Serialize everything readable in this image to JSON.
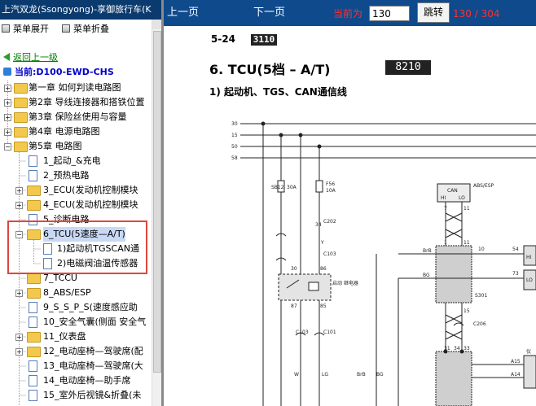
{
  "window": {
    "title": "上汽双龙(Ssongyong)-享御旅行车(K"
  },
  "menu": {
    "expand_label": "菜单展开",
    "collapse_label": "菜单折叠"
  },
  "nav": {
    "back_label": "返回上一级",
    "current_label": "当前:D100-EWD-CHS"
  },
  "tree": {
    "items": [
      {
        "label": "第一章 如何判读电路图"
      },
      {
        "label": "第2章 导线连接器和搭铁位置"
      },
      {
        "label": "第3章 保险丝使用与容量"
      },
      {
        "label": "第4章 电源电路图"
      },
      {
        "label": "第5章 电路图"
      },
      {
        "label": "1_起动_&充电"
      },
      {
        "label": "2_预热电路"
      },
      {
        "label": "3_ECU(发动机控制模块"
      },
      {
        "label": "4_ECU(发动机控制模块"
      },
      {
        "label": "5_诊断电路"
      },
      {
        "label": "6_TCU(5速度—A/T)"
      },
      {
        "label": "1)起动机TGSCAN通"
      },
      {
        "label": "2)电磁阀油温传感器"
      },
      {
        "label": "7_TCCU"
      },
      {
        "label": "8_ABS/ESP"
      },
      {
        "label": "9_S_S_P_S(速度感应助"
      },
      {
        "label": "10_安全气囊(侧面 安全气"
      },
      {
        "label": "11_仪表盘"
      },
      {
        "label": "12_电动座椅—驾驶席(配"
      },
      {
        "label": "13_电动座椅—驾驶席(大"
      },
      {
        "label": "14_电动座椅—助手席"
      },
      {
        "label": "15_室外后视镜&折叠(未"
      }
    ]
  },
  "toolbar": {
    "prev_label": "上一页",
    "next_label": "下一页",
    "page_label": "当前为",
    "page_value": "130",
    "jump_label": "跳转",
    "page_count": "130 / 304"
  },
  "document": {
    "page_ref": "5-24",
    "code1": "3110",
    "title": "6. TCU(5档 – A/T)",
    "code2": "8210",
    "subtitle": "1) 起动机、TGS、CAN通信线",
    "diagram": {
      "wire_labels": [
        "30",
        "15",
        "50",
        "58"
      ],
      "fuse_sb": "SB12",
      "fuse_sb_rating": "30A",
      "fuse_f": "F56",
      "fuse_f_rating": "10A",
      "relay_label": "启动\n继电器",
      "relay_pins": [
        "30",
        "86",
        "87",
        "85"
      ],
      "connectors": [
        "C202",
        "C103",
        "C103",
        "C101",
        "C206"
      ],
      "pins_small": [
        "34",
        "7",
        "11",
        "1",
        "11",
        "15",
        "31",
        "34",
        "33"
      ],
      "wire_colors": [
        "Y",
        "BrB",
        "BG",
        "W",
        "LG",
        "BrB",
        "BG"
      ],
      "can_box": "CAN",
      "can_hi": "HI",
      "can_lo": "LO",
      "abs_esp": "ABS/ESP",
      "s301": "S301",
      "right_labels": [
        "10",
        "54",
        "73",
        "HI",
        "LO",
        "A15",
        "A14",
        "仪"
      ]
    }
  }
}
